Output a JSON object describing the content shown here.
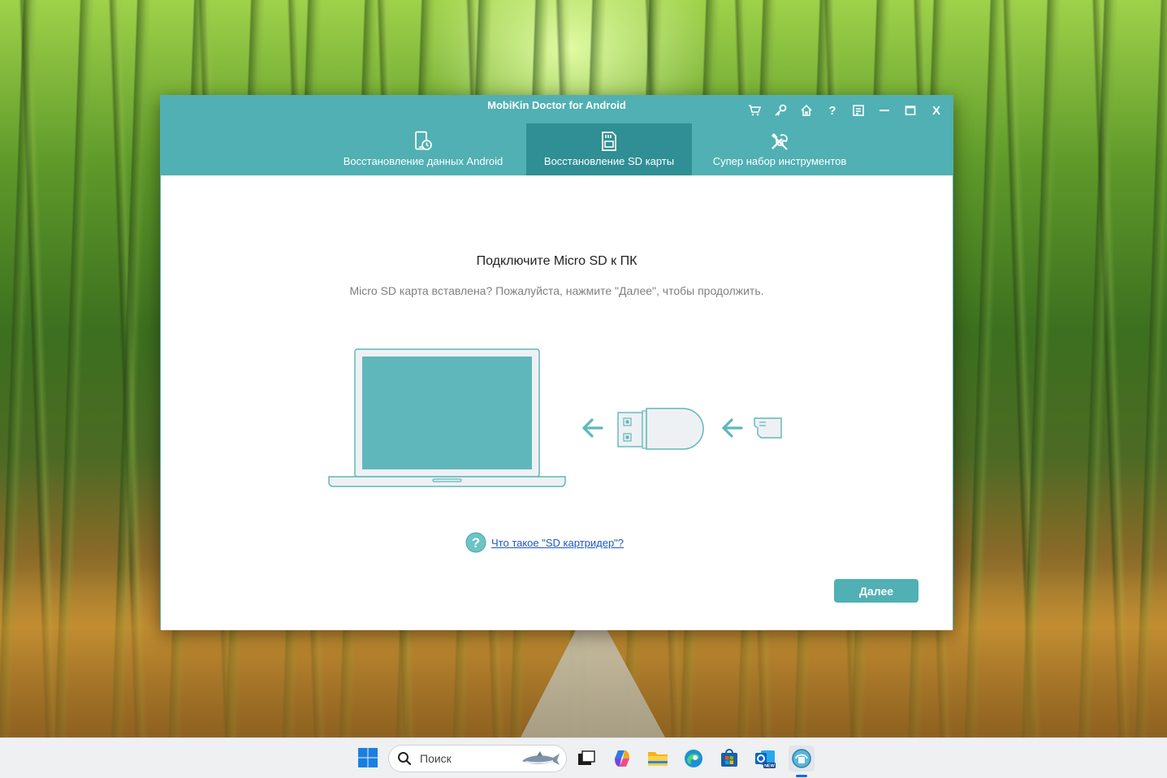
{
  "window": {
    "title": "MobiKin Doctor for Android",
    "controls": [
      "cart-icon",
      "key-icon",
      "home-icon",
      "help-icon",
      "feedback-icon",
      "minimize-icon",
      "maximize-icon",
      "close-icon"
    ],
    "close_label": "X"
  },
  "tabs": [
    {
      "label": "Восстановление данных Android",
      "icon": "phone-restore-icon",
      "active": false
    },
    {
      "label": "Восстановление SD карты",
      "icon": "sd-card-icon",
      "active": true
    },
    {
      "label": "Супер набор инструментов",
      "icon": "tools-icon",
      "active": false
    }
  ],
  "main": {
    "heading": "Подключите Micro SD к ПК",
    "subheading": "Micro SD карта вставлена? Пожалуйста, нажмите \"Далее\", чтобы продолжить.",
    "help_link": "Что такое \"SD картридер\"?",
    "next_button": "Далее"
  },
  "taskbar": {
    "search_placeholder": "Поиск",
    "icons": [
      "windows-start-icon",
      "search-icon",
      "task-view-icon",
      "copilot-icon",
      "file-explorer-icon",
      "edge-icon",
      "store-icon",
      "outlook-icon",
      "mobikin-app-icon"
    ]
  },
  "colors": {
    "accent": "#50b0b3",
    "accent_active": "#2f8f94",
    "link": "#1a57c9"
  }
}
